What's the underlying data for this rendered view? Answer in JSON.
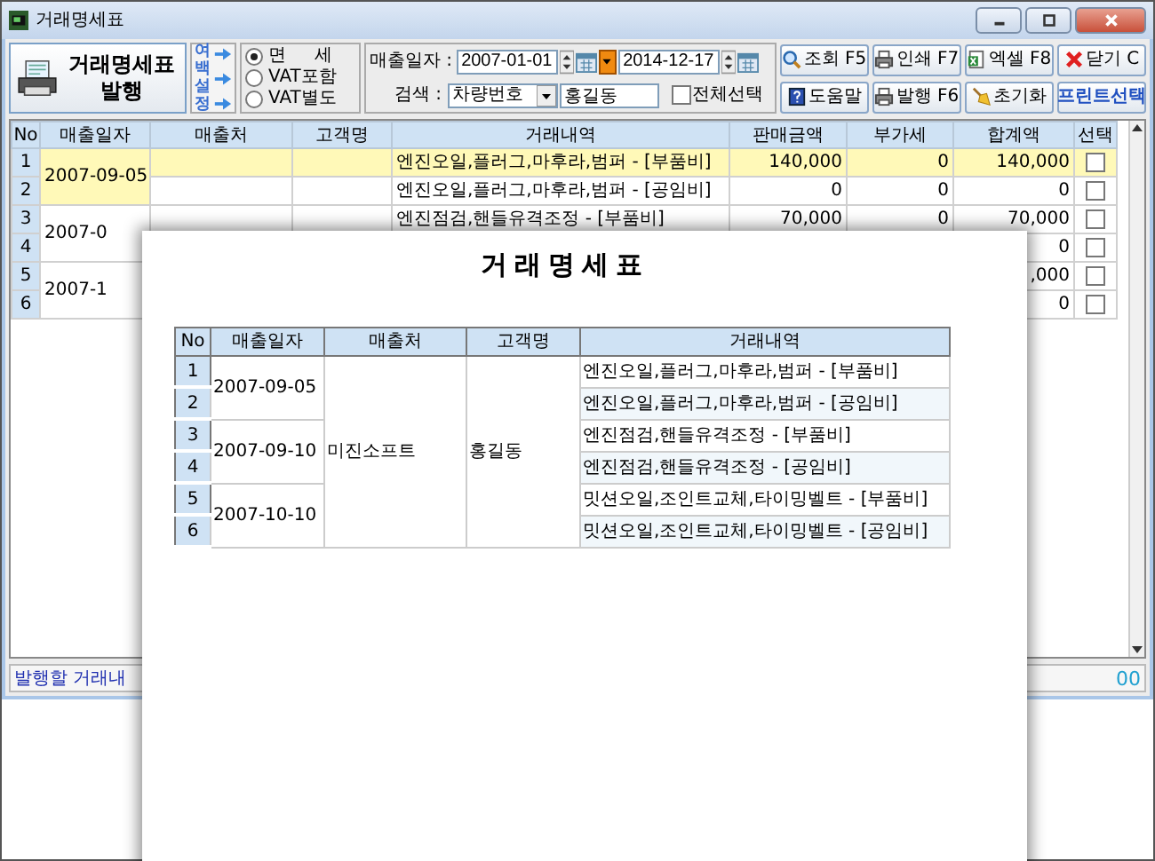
{
  "window": {
    "title": "거래명세표"
  },
  "toolbar": {
    "issue_button": "거래명세표 발행",
    "margin_setting": "여백설정",
    "vat_options": [
      {
        "label": "면     세",
        "selected": true
      },
      {
        "label": "VAT포함",
        "selected": false
      },
      {
        "label": "VAT별도",
        "selected": false
      }
    ],
    "date_label": "매출일자 :",
    "date_from": "2007-01-01",
    "date_to": "2014-12-17",
    "search_label": "검색 :",
    "search_field": "차량번호",
    "search_value": "홍길동",
    "select_all": {
      "label": "전체선택",
      "checked": false
    },
    "buttons": [
      "조회 F5",
      "인쇄 F7",
      "엑셀 F8",
      "닫기 C",
      "도움말",
      "발행 F6",
      "초기화",
      "프린트선택"
    ]
  },
  "grid": {
    "columns": [
      "No",
      "매출일자",
      "매출처",
      "고객명",
      "거래내역",
      "판매금액",
      "부가세",
      "합계액",
      "선택"
    ],
    "date_groups": [
      "2007-09-05",
      "2007-0",
      "2007-1"
    ],
    "rows": [
      {
        "no": "1",
        "selected": true,
        "checked": false,
        "description": "엔진오일,플러그,마후라,범퍼 - [부품비]",
        "sale": "140,000",
        "vat": "0",
        "total": "140,000"
      },
      {
        "no": "2",
        "selected": false,
        "checked": false,
        "description": "엔진오일,플러그,마후라,범퍼 - [공임비]",
        "sale": "0",
        "vat": "0",
        "total": "0"
      },
      {
        "no": "3",
        "selected": false,
        "checked": false,
        "description": "엔진점검,핸들유격조정 - [부품비]",
        "sale": "70,000",
        "vat": "0",
        "total": "70,000"
      },
      {
        "no": "4",
        "selected": false,
        "checked": false,
        "total": "0"
      },
      {
        "no": "5",
        "selected": false,
        "checked": false,
        "total": ",000"
      },
      {
        "no": "6",
        "selected": false,
        "checked": false,
        "total": "0"
      }
    ]
  },
  "status_bar": {
    "message": "발행할 거래내",
    "amount": "00"
  },
  "preview": {
    "title": "거래명세표",
    "columns": [
      "No",
      "매출일자",
      "매출처",
      "고객명",
      "거래내역"
    ],
    "vendor": "미진소프트",
    "customer": "홍길동",
    "date_groups": [
      "2007-09-05",
      "2007-09-10",
      "2007-10-10"
    ],
    "rows": [
      {
        "no": "1",
        "description": "엔진오일,플러그,마후라,범퍼 - [부품비]"
      },
      {
        "no": "2",
        "description": "엔진오일,플러그,마후라,범퍼 - [공임비]"
      },
      {
        "no": "3",
        "description": "엔진점검,핸들유격조정 - [부품비]"
      },
      {
        "no": "4",
        "description": "엔진점검,핸들유격조정 - [공임비]"
      },
      {
        "no": "5",
        "description": "밋션오일,조인트교체,타이밍벨트 - [부품비]"
      },
      {
        "no": "6",
        "description": "밋션오일,조인트교체,타이밍벨트 - [공임비]"
      }
    ]
  }
}
